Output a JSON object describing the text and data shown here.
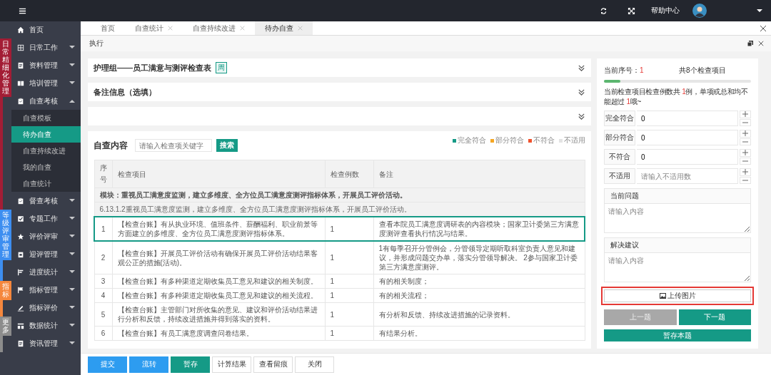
{
  "topbar": {
    "help": "帮助中心"
  },
  "sidebar": {
    "home": {
      "label": "首页"
    },
    "sections": [
      {
        "label": "日常精细化管理",
        "color": "#a31d35",
        "items": [
          {
            "label": "日常工作",
            "expanded": false
          },
          {
            "label": "资料管理",
            "expanded": false
          },
          {
            "label": "培训管理",
            "expanded": false
          },
          {
            "label": "自查考核",
            "expanded": true,
            "children": [
              {
                "label": "自查模板",
                "selected": false
              },
              {
                "label": "待办自查",
                "selected": true
              },
              {
                "label": "自查持续改进",
                "selected": false
              },
              {
                "label": "我的自查",
                "selected": false
              },
              {
                "label": "自查统计",
                "selected": false
              }
            ]
          },
          {
            "label": "督查考核",
            "expanded": false
          }
        ]
      },
      {
        "label": "等级评审管理",
        "color": "#3d8ef0",
        "items": [
          {
            "label": "专题工作",
            "expanded": false
          },
          {
            "label": "评价评审",
            "expanded": false
          },
          {
            "label": "迎评管理",
            "expanded": false
          },
          {
            "label": "进度统计",
            "expanded": false
          }
        ]
      },
      {
        "label": "指标",
        "color": "#f5873d",
        "items": [
          {
            "label": "指标管理",
            "expanded": false
          },
          {
            "label": "指标评价",
            "expanded": false
          }
        ]
      },
      {
        "label": "更多",
        "color": "#8c8c8c",
        "items": [
          {
            "label": "数据统计",
            "expanded": false
          },
          {
            "label": "资讯管理",
            "expanded": false
          }
        ]
      }
    ]
  },
  "tabs": [
    {
      "label": "首页",
      "closable": false,
      "selected": false
    },
    {
      "label": "自查统计",
      "closable": true,
      "selected": false
    },
    {
      "label": "自查持续改进",
      "closable": true,
      "selected": false
    },
    {
      "label": "待办自查",
      "closable": true,
      "selected": true
    }
  ],
  "breadcrumb": "执行",
  "sections": [
    {
      "title": "护理组——员工满意与测评检查表",
      "tag": "周",
      "expanded": false
    },
    {
      "title": "备注信息（选填）",
      "expanded": false
    },
    {
      "expanded": false
    }
  ],
  "self_check": {
    "title": "自查内容",
    "search": {
      "placeholder": "请输入检查项关键字",
      "button": "搜索"
    },
    "legend": [
      {
        "label": "完全符合",
        "color": "#159a86"
      },
      {
        "label": "部分符合",
        "color": "#f5a623"
      },
      {
        "label": "不符合",
        "color": "#f0522d"
      },
      {
        "label": "不适用",
        "color": "#e3e3e3"
      }
    ],
    "table": {
      "columns": [
        "序号",
        "检查项目",
        "检查例数",
        "备注"
      ],
      "module": "模块：重视员工满意度监测，建立多维度、全方位员工满意度测评指标体系，开展员工评价活动。",
      "clause": "6.13.1.2重视员工满意度监测，建立多维度、全方位员工满意度测评指标体系，开展员工评价活动。",
      "rows": [
        {
          "no": "1",
          "item": "【检查台账】有从执业环境、值班条件、薪酬福利、职业前景等方面建立的多维度、全方位员工满意度测评指标体系。",
          "count": "1",
          "note": "查看本院员工满意度调研表的内容模块；国家卫计委第三方满意度测评查看执行情况与结果。",
          "selected": true
        },
        {
          "no": "2",
          "item": "【检查台账】开展员工评价活动有确保开展员工评价活动结果客观公正的措施(活动)。",
          "count": "1",
          "note": "1有每季召开分管例会，分管领导定期听取科室负责人意见和建议，并形成问题交办单，落实分管领导解决。 2参与国家卫计委第三方满意度测评。",
          "selected": false
        },
        {
          "no": "3",
          "item": "【检查台账】有多种渠道定期收集员工意见和建议的相关制度。",
          "count": "1",
          "note": "有的相关制度；",
          "selected": false
        },
        {
          "no": "4",
          "item": "【检查台账】有多种渠道定期收集员工意见和建议的相关流程。",
          "count": "1",
          "note": "有的相关流程；",
          "selected": false
        },
        {
          "no": "5",
          "item": "【检查台账】主管部门对所收集的意见、建议和评价活动结果进行分析和反馈，持续改进措施并得到落实的资料。",
          "count": "1",
          "note": "有分析和反馈、持续改进措施的记录资料。",
          "selected": false
        },
        {
          "no": "6",
          "item": "【检查台账】有员工满意度调查问卷结果。",
          "count": "1",
          "note": "有结果分析。",
          "selected": false
        }
      ]
    }
  },
  "check_panel": {
    "current_label": "当前序号：",
    "current_value": "1",
    "total": "共8个检查项目",
    "progress": {
      "level": 0.11
    },
    "notice": [
      {
        "text": "当前检查项目检查例数共 ",
        "highlight": false
      },
      {
        "text": "1",
        "highlight": true
      },
      {
        "text": "例，单项或总和均不能超过 ",
        "highlight": false
      },
      {
        "text": "1",
        "highlight": true
      },
      {
        "text": "哦~",
        "highlight": false
      }
    ],
    "counters": [
      {
        "label": "完全符合",
        "value": "0"
      },
      {
        "label": "部分符合",
        "value": "0"
      },
      {
        "label": "不符合",
        "value": "0"
      },
      {
        "label": "不适用",
        "placeholder": "请输入不适用数"
      }
    ],
    "notes": [
      {
        "label": "当前问题",
        "placeholder": "请输入内容"
      },
      {
        "label": "解决建议",
        "placeholder": "请输入内容"
      }
    ],
    "upload": {
      "label": "上传图片",
      "annotated": true
    },
    "nav": [
      {
        "label": "上一题",
        "disabled": true
      },
      {
        "label": "下一题",
        "disabled": false
      }
    ],
    "save": "暂存本题"
  },
  "footer_buttons": [
    {
      "label": "提交",
      "kind": "primary"
    },
    {
      "label": "流转",
      "kind": "primary"
    },
    {
      "label": "暂存",
      "kind": "teal"
    },
    {
      "label": "计算结果",
      "kind": "default"
    },
    {
      "label": "查看留痕",
      "kind": "default"
    },
    {
      "label": "关闭",
      "kind": "default"
    }
  ]
}
